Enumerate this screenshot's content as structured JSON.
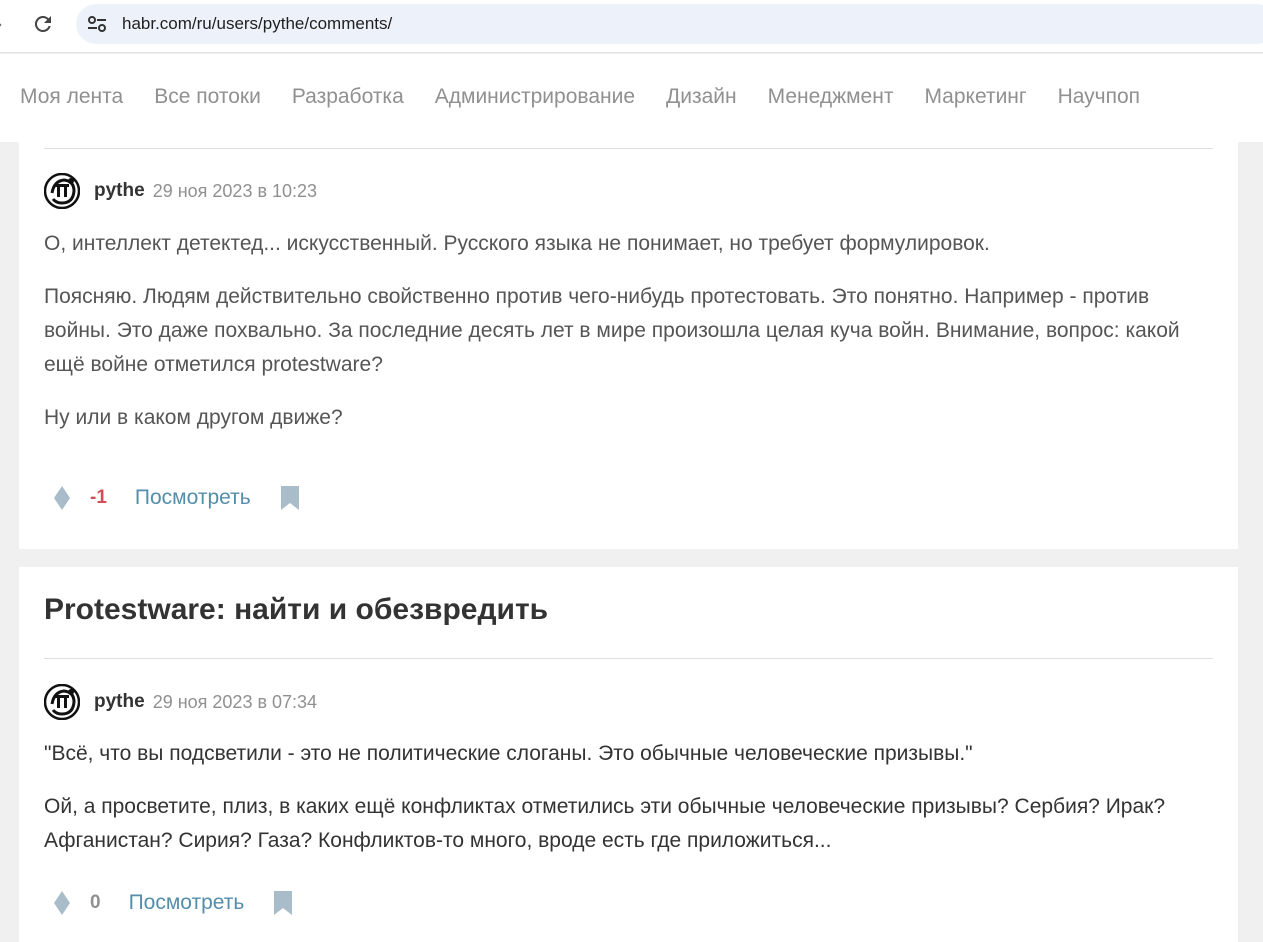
{
  "browser": {
    "url": "habr.com/ru/users/pythe/comments/",
    "icons": {
      "forward": "forward-arrow-icon",
      "reload": "reload-icon",
      "site_info": "site-settings-icon"
    }
  },
  "nav": {
    "items": [
      "Моя лента",
      "Все потоки",
      "Разработка",
      "Администрирование",
      "Дизайн",
      "Менеджмент",
      "Маркетинг",
      "Научпоп"
    ]
  },
  "comments": [
    {
      "author": "pythe",
      "time": "29 ноя 2023 в 10:23",
      "paragraphs": [
        "О, интеллект детектед... искусственный. Русского языка не понимает, но требует формулировок.",
        "Поясняю. Людям действительно свойственно против чего-нибудь протестовать. Это понятно. Например - против войны. Это даже похвально. За последние десять лет в мире произошла целая куча войн. Внимание, вопрос: какой ещё войне отметился protestware?",
        "Ну или в каком другом движе?"
      ],
      "score": "-1",
      "view_label": "Посмотреть"
    },
    {
      "post_title": "Protestware: найти и обезвредить",
      "author": "pythe",
      "time": "29 ноя 2023 в 07:34",
      "paragraphs": [
        "\"Всё, что вы подсветили - это не политические слоганы. Это обычные человеческие призывы.\"",
        "Ой, а просветите, плиз, в каких ещё конфликтах отметились эти обычные человеческие призывы? Сербия? Ирак? Афганистан? Сирия? Газа? Конфликтов-то много, вроде есть где приложиться..."
      ],
      "score": "0",
      "view_label": "Посмотреть"
    }
  ],
  "colors": {
    "negative_score": "#d04e56",
    "link": "#548eaa",
    "muted": "#909090",
    "icon": "#a9bcca"
  }
}
